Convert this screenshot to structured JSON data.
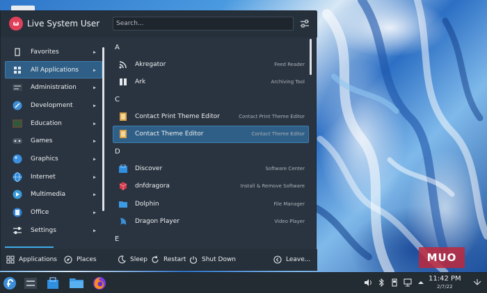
{
  "header": {
    "user_name": "Live System User",
    "avatar_glyph": "ω",
    "search_placeholder": "Search..."
  },
  "categories": [
    {
      "label": "Favorites",
      "icon": "bookmark-icon",
      "active": false
    },
    {
      "label": "All Applications",
      "icon": "grid-icon",
      "active": true
    },
    {
      "label": "Administration",
      "icon": "admin-icon",
      "active": false
    },
    {
      "label": "Development",
      "icon": "development-icon",
      "active": false
    },
    {
      "label": "Education",
      "icon": "education-icon",
      "active": false
    },
    {
      "label": "Games",
      "icon": "gamepad-icon",
      "active": false
    },
    {
      "label": "Graphics",
      "icon": "graphics-icon",
      "active": false
    },
    {
      "label": "Internet",
      "icon": "globe-icon",
      "active": false
    },
    {
      "label": "Multimedia",
      "icon": "multimedia-icon",
      "active": false
    },
    {
      "label": "Office",
      "icon": "office-icon",
      "active": false
    },
    {
      "label": "Settings",
      "icon": "settings-icon",
      "active": false
    }
  ],
  "sections": {
    "a": "A",
    "c": "C",
    "d": "D",
    "e": "E"
  },
  "apps": {
    "akregator": {
      "name": "Akregator",
      "desc": "Feed Reader"
    },
    "ark": {
      "name": "Ark",
      "desc": "Archiving Tool"
    },
    "contact_print": {
      "name": "Contact Print Theme Editor",
      "desc": "Contact Print Theme Editor"
    },
    "contact_theme": {
      "name": "Contact Theme Editor",
      "desc": "Contact Theme Editor"
    },
    "discover": {
      "name": "Discover",
      "desc": "Software Center"
    },
    "dnfdragora": {
      "name": "dnfdragora",
      "desc": "Install & Remove Software"
    },
    "dolphin": {
      "name": "Dolphin",
      "desc": "File Manager"
    },
    "dragon": {
      "name": "Dragon Player",
      "desc": "Video Player"
    }
  },
  "footer": {
    "applications": "Applications",
    "places": "Places",
    "sleep": "Sleep",
    "restart": "Restart",
    "shutdown": "Shut Down",
    "leave": "Leave..."
  },
  "taskbar": {
    "time": "11:42 PM",
    "date": "2/7/22"
  },
  "watermark": "MUO",
  "colors": {
    "accent": "#3daee9",
    "highlight": "#2f5f86",
    "panel": "#2a3440",
    "avatar": "#e0405a"
  }
}
